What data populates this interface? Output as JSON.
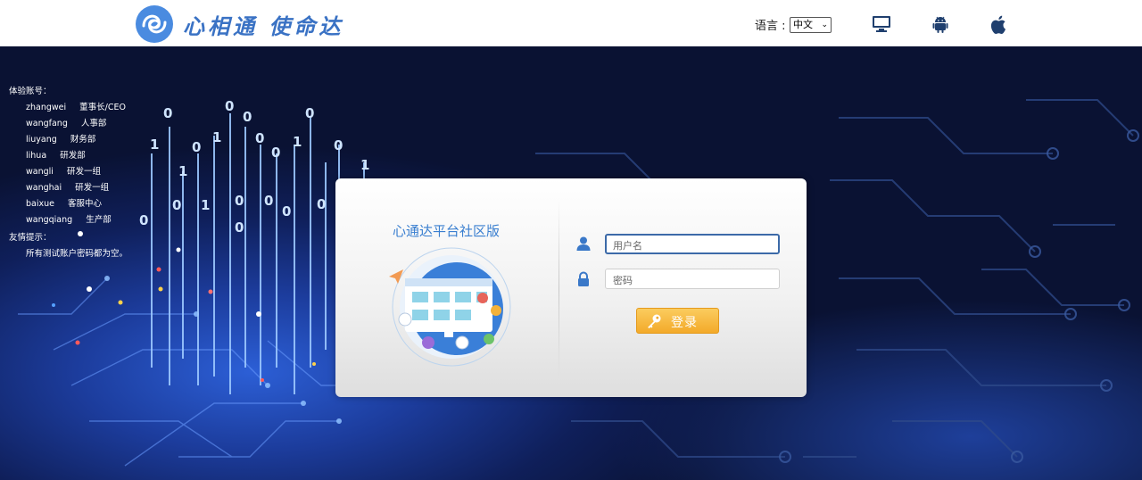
{
  "header": {
    "logo_text": "心相通 使命达",
    "language_label": "语言 :",
    "language_selected": "中文",
    "platforms": [
      "desktop-icon",
      "android-icon",
      "apple-icon"
    ]
  },
  "info": {
    "title": "体验账号：",
    "accounts": [
      {
        "user": "zhangwei",
        "role": "董事长/CEO"
      },
      {
        "user": "wangfang",
        "role": "人事部"
      },
      {
        "user": "liuyang",
        "role": "财务部"
      },
      {
        "user": "lihua",
        "role": "研发部"
      },
      {
        "user": "wangli",
        "role": "研发一组"
      },
      {
        "user": "wanghai",
        "role": "研发一组"
      },
      {
        "user": "baixue",
        "role": "客服中心"
      },
      {
        "user": "wangqiang",
        "role": "生产部"
      }
    ],
    "tip_title": "友情提示：",
    "tip_text": "所有测试账户密码都为空。"
  },
  "login": {
    "title": "心通达平台社区版",
    "username_placeholder": "用户名",
    "password_placeholder": "密码",
    "button_label": "登录"
  },
  "colors": {
    "brand": "#3a72c4",
    "login_button": "#f3aa2a",
    "background": "#0a1233"
  }
}
